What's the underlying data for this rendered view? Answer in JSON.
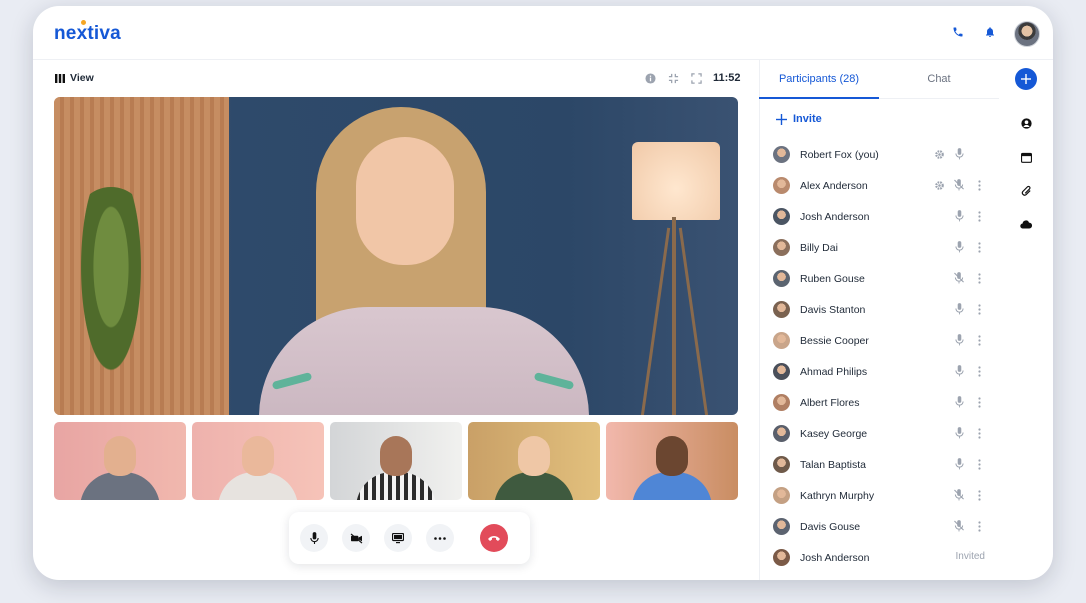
{
  "brand": {
    "name": "nextiva"
  },
  "toolbar": {
    "view_label": "View",
    "time": "11:52"
  },
  "panel": {
    "tabs": [
      {
        "label": "Participants (28)",
        "active": true
      },
      {
        "label": "Chat",
        "active": false
      }
    ],
    "invite_label": "Invite",
    "participants": [
      {
        "name": "Robert Fox (you)",
        "settings": true,
        "mic": "on",
        "more": false,
        "status": ""
      },
      {
        "name": "Alex Anderson",
        "settings": true,
        "mic": "muted",
        "more": true,
        "status": ""
      },
      {
        "name": "Josh Anderson",
        "settings": false,
        "mic": "on",
        "more": true,
        "status": ""
      },
      {
        "name": "Billy Dai",
        "settings": false,
        "mic": "on",
        "more": true,
        "status": ""
      },
      {
        "name": "Ruben Gouse",
        "settings": false,
        "mic": "muted",
        "more": true,
        "status": ""
      },
      {
        "name": "Davis Stanton",
        "settings": false,
        "mic": "on",
        "more": true,
        "status": ""
      },
      {
        "name": "Bessie Cooper",
        "settings": false,
        "mic": "on",
        "more": true,
        "status": ""
      },
      {
        "name": "Ahmad Philips",
        "settings": false,
        "mic": "on",
        "more": true,
        "status": ""
      },
      {
        "name": "Albert Flores",
        "settings": false,
        "mic": "on",
        "more": true,
        "status": ""
      },
      {
        "name": "Kasey George",
        "settings": false,
        "mic": "on",
        "more": true,
        "status": ""
      },
      {
        "name": "Talan Baptista",
        "settings": false,
        "mic": "on",
        "more": true,
        "status": ""
      },
      {
        "name": "Kathryn Murphy",
        "settings": false,
        "mic": "muted",
        "more": true,
        "status": ""
      },
      {
        "name": "Davis Gouse",
        "settings": false,
        "mic": "muted",
        "more": true,
        "status": ""
      },
      {
        "name": "Josh Anderson",
        "settings": false,
        "mic": "",
        "more": false,
        "status": "Invited"
      }
    ]
  },
  "colors": {
    "accent": "#1558d6",
    "end_call": "#e24b5a",
    "brand_dot": "#f5a623"
  },
  "icons": {
    "header": [
      "phone-icon",
      "bell-icon"
    ],
    "rail": [
      "plus-icon",
      "user-icon",
      "calendar-icon",
      "paperclip-icon",
      "cloud-icon"
    ],
    "controls": [
      "microphone-icon",
      "video-off-icon",
      "screen-share-icon",
      "more-icon",
      "end-call-icon"
    ]
  }
}
